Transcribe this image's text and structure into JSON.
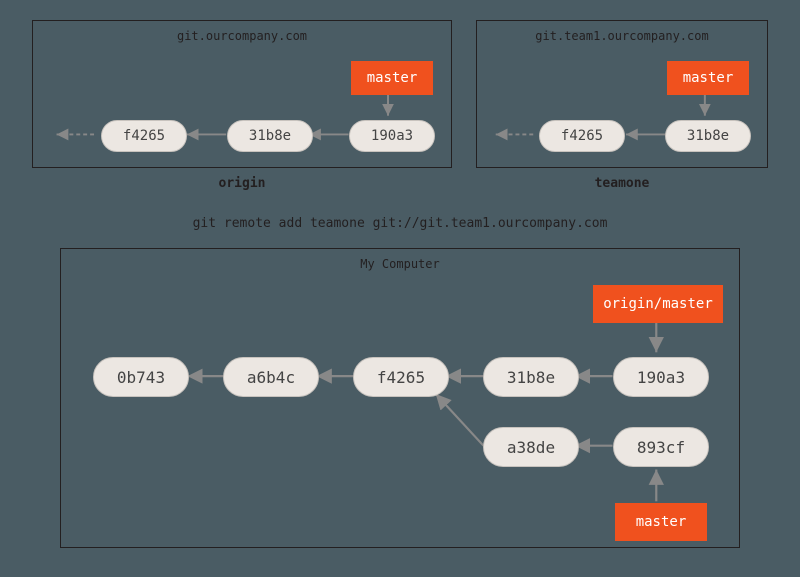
{
  "origin": {
    "host": "git.ourcompany.com",
    "label": "origin",
    "branch": "master",
    "commits": [
      "f4265",
      "31b8e",
      "190a3"
    ]
  },
  "teamone": {
    "host": "git.team1.ourcompany.com",
    "label": "teamone",
    "branch": "master",
    "commits": [
      "f4265",
      "31b8e"
    ]
  },
  "command": "git remote add teamone git://git.team1.ourcompany.com",
  "local": {
    "title": "My Computer",
    "remote_branch": "origin/master",
    "local_branch": "master",
    "commits_main": [
      "0b743",
      "a6b4c",
      "f4265",
      "31b8e",
      "190a3"
    ],
    "commits_branch": [
      "a38de",
      "893cf"
    ]
  }
}
